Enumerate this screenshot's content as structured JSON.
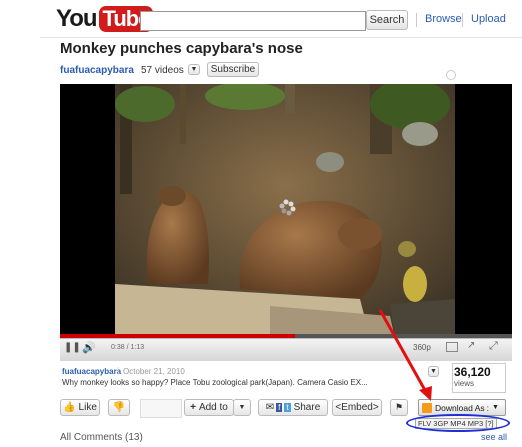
{
  "header": {
    "logo_you": "You",
    "logo_tube": "Tube",
    "search_value": "",
    "search_button": "Search",
    "browse": "Browse",
    "upload": "Upload"
  },
  "video": {
    "title": "Monkey punches capybara's nose",
    "channel": "fuafuacapybara",
    "video_count": "57 videos",
    "subscribe": "Subscribe",
    "time": "0:38 / 1:13",
    "progress_fraction": 0.52,
    "quality": "360p"
  },
  "info": {
    "uploader": "fuafuacapybara",
    "date": "October 21, 2010",
    "description": "Why monkey looks so happy? Place Tobu zoological park(Japan). Camera Casio EX...",
    "views_count": "36,120",
    "views_label": "views"
  },
  "actions": {
    "like": "Like",
    "add_to": "Add to",
    "share": "Share",
    "embed": "<Embed>",
    "download": "Download As",
    "formats": "FLV 3GP MP4 MP3 [?]"
  },
  "comments": {
    "label": "All Comments (13)",
    "see_all": "see all"
  },
  "colors": {
    "brand_red": "#d11c1c",
    "link_blue": "#2a5db0",
    "annotation_red": "#e01010",
    "annotation_blue": "#1e2fd6"
  }
}
